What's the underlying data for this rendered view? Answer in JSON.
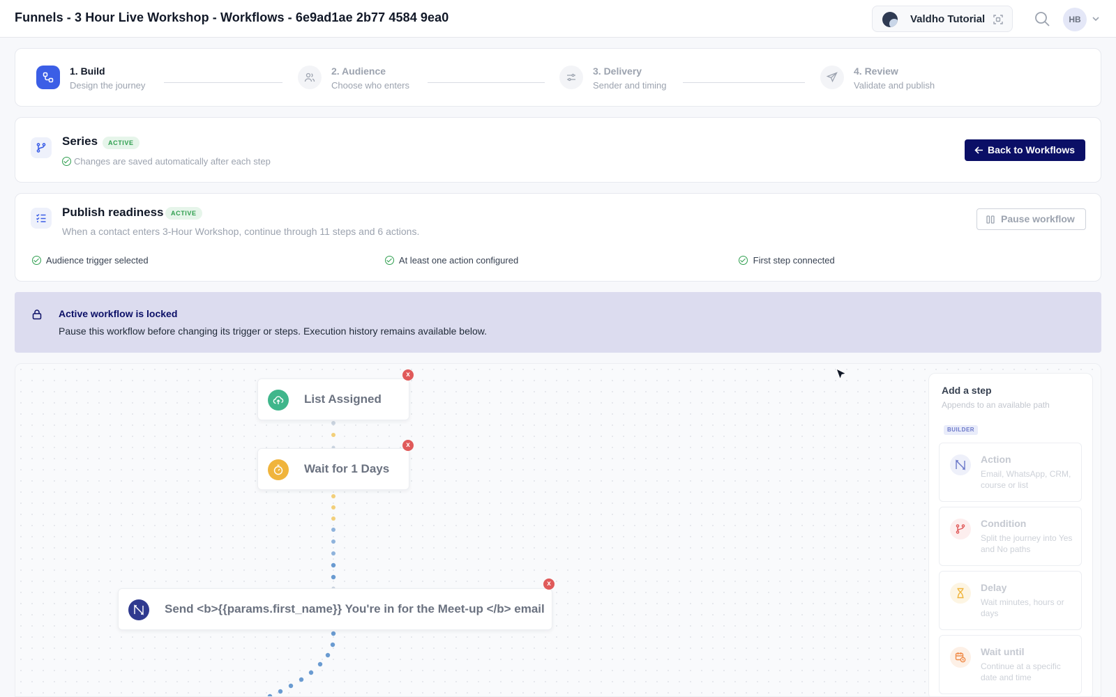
{
  "header": {
    "title": "Funnels - 3 Hour Live Workshop - Workflows - 6e9ad1ae 2b77 4584 9ea0",
    "account_name": "Valdho Tutorial",
    "user_initials": "HB"
  },
  "stepper": {
    "steps": [
      {
        "title": "1. Build",
        "subtitle": "Design the journey",
        "icon": "workflow-icon",
        "active": true
      },
      {
        "title": "2. Audience",
        "subtitle": "Choose who enters",
        "icon": "users-icon",
        "active": false
      },
      {
        "title": "3. Delivery",
        "subtitle": "Sender and timing",
        "icon": "sliders-icon",
        "active": false
      },
      {
        "title": "4. Review",
        "subtitle": "Validate and publish",
        "icon": "send-icon",
        "active": false
      }
    ]
  },
  "series": {
    "title": "Series",
    "status": "ACTIVE",
    "saved_note": "Changes are saved automatically after each step",
    "back_label": "Back to Workflows"
  },
  "readiness": {
    "title": "Publish readiness",
    "status": "ACTIVE",
    "description": "When a contact enters 3-Hour Workshop, continue through 11 steps and 6 actions.",
    "pause_label": "Pause workflow",
    "checks": [
      "Audience trigger selected",
      "At least one action configured",
      "First step connected"
    ]
  },
  "lock_banner": {
    "title": "Active workflow is locked",
    "description": "Pause this workflow before changing its trigger or steps. Execution history remains available below."
  },
  "canvas": {
    "nodes": [
      {
        "label": "List Assigned",
        "icon": "cloud-icon",
        "color": "#3fb68b"
      },
      {
        "label": "Wait for 1 Days",
        "icon": "timer-icon",
        "color": "#f0b43c"
      },
      {
        "label": "Send <b>{{params.first_name}} You're in for the Meet-up </b> email",
        "icon": "action-icon",
        "color": "#2f3a8f"
      }
    ],
    "remove_symbol": "x"
  },
  "add_panel": {
    "title": "Add a step",
    "subtitle": "Appends to an available path",
    "tag": "BUILDER",
    "items": [
      {
        "title": "Action",
        "description": "Email, WhatsApp, CRM, course or list",
        "icon": "action-icon",
        "color": "#6b78c9"
      },
      {
        "title": "Condition",
        "description": "Split the journey into Yes and No paths",
        "icon": "branch-icon",
        "color": "#e05a5a"
      },
      {
        "title": "Delay",
        "description": "Wait minutes, hours or days",
        "icon": "hourglass-icon",
        "color": "#f0b43c"
      },
      {
        "title": "Wait until",
        "description": "Continue at a specific date and time",
        "icon": "calendar-clock-icon",
        "color": "#f08c4a"
      }
    ]
  },
  "colors": {
    "accent": "#3b5ee6",
    "navy": "#0b0f66",
    "success": "#2e9e4e",
    "banner": "#dcdcef"
  }
}
